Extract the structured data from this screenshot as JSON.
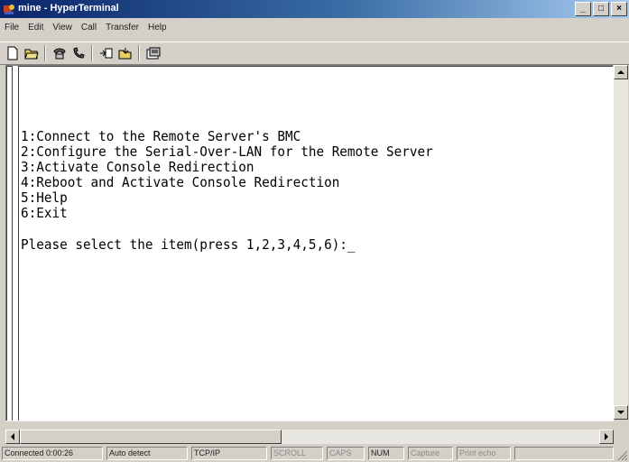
{
  "window": {
    "title": "mine - HyperTerminal"
  },
  "menubar": [
    "File",
    "Edit",
    "View",
    "Call",
    "Transfer",
    "Help"
  ],
  "toolbar": {
    "buttons": [
      "new-connection",
      "open",
      "connect",
      "disconnect",
      "send",
      "receive",
      "properties"
    ]
  },
  "terminal": {
    "lines": [
      "1:Connect to the Remote Server's BMC",
      "2:Configure the Serial-Over-LAN for the Remote Server",
      "3:Activate Console Redirection",
      "4:Reboot and Activate Console Redirection",
      "5:Help",
      "6:Exit",
      "",
      "Please select the item(press 1,2,3,4,5,6):_"
    ]
  },
  "statusbar": {
    "connected": "Connected 0:00:26",
    "detect": "Auto detect",
    "protocol": "TCP/IP",
    "scroll": "SCROLL",
    "caps": "CAPS",
    "num": "NUM",
    "capture": "Capture",
    "print_echo": "Print echo"
  },
  "colors": {
    "titlebar_start": "#0a246a",
    "titlebar_end": "#a6caf0",
    "terminal_bg": "#ffffff",
    "chrome": "#d4d0c8"
  }
}
